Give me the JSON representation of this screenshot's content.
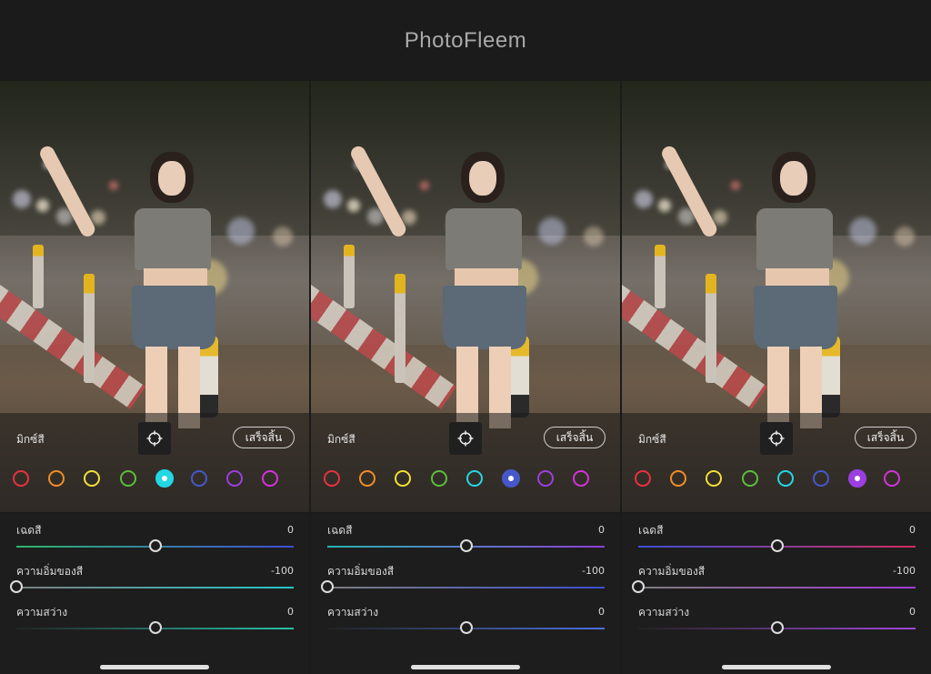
{
  "app": {
    "brand": "PhotoFleem"
  },
  "colors": {
    "red": "#e8323f",
    "orange": "#f08d26",
    "yellow": "#f1df35",
    "green": "#5bbd3e",
    "aqua": "#23d7e3",
    "blue": "#4658c9",
    "purple": "#9b3fe0",
    "magenta": "#d233d8"
  },
  "panels": [
    {
      "mix_label": "มิกซ์สี",
      "done_label": "เสร็จสิ้น",
      "target_icon": "target-adjust-icon",
      "selected_color": "aqua",
      "sliders": [
        {
          "label": "เฉดสี",
          "value": "0",
          "position": 0.5,
          "gradient": [
            "#2bb56a",
            "#3f4ed6"
          ]
        },
        {
          "label": "ความอิ่มของสี",
          "value": "-100",
          "position": 0.0,
          "gradient": [
            "#7d7d7d",
            "#23c6c8"
          ]
        },
        {
          "label": "ความสว่าง",
          "value": "0",
          "position": 0.5,
          "gradient": [
            "#222222",
            "#28c0a8"
          ]
        }
      ]
    },
    {
      "mix_label": "มิกซ์สี",
      "done_label": "เสร็จสิ้น",
      "target_icon": "target-adjust-icon",
      "selected_color": "blue",
      "sliders": [
        {
          "label": "เฉดสี",
          "value": "0",
          "position": 0.5,
          "gradient": [
            "#26b3b1",
            "#8d3ed6"
          ]
        },
        {
          "label": "ความอิ่มของสี",
          "value": "-100",
          "position": 0.0,
          "gradient": [
            "#7d7d7d",
            "#3e4fd1"
          ]
        },
        {
          "label": "ความสว่าง",
          "value": "0",
          "position": 0.5,
          "gradient": [
            "#222222",
            "#4b6fdb"
          ]
        }
      ]
    },
    {
      "mix_label": "มิกซ์สี",
      "done_label": "เสร็จสิ้น",
      "target_icon": "target-adjust-icon",
      "selected_color": "purple",
      "sliders": [
        {
          "label": "เฉดสี",
          "value": "0",
          "position": 0.5,
          "gradient": [
            "#3f4ed6",
            "#d12c5e"
          ]
        },
        {
          "label": "ความอิ่มของสี",
          "value": "-100",
          "position": 0.0,
          "gradient": [
            "#7d7d7d",
            "#a23ad6"
          ]
        },
        {
          "label": "ความสว่าง",
          "value": "0",
          "position": 0.5,
          "gradient": [
            "#222222",
            "#9f48d8"
          ]
        }
      ]
    }
  ]
}
